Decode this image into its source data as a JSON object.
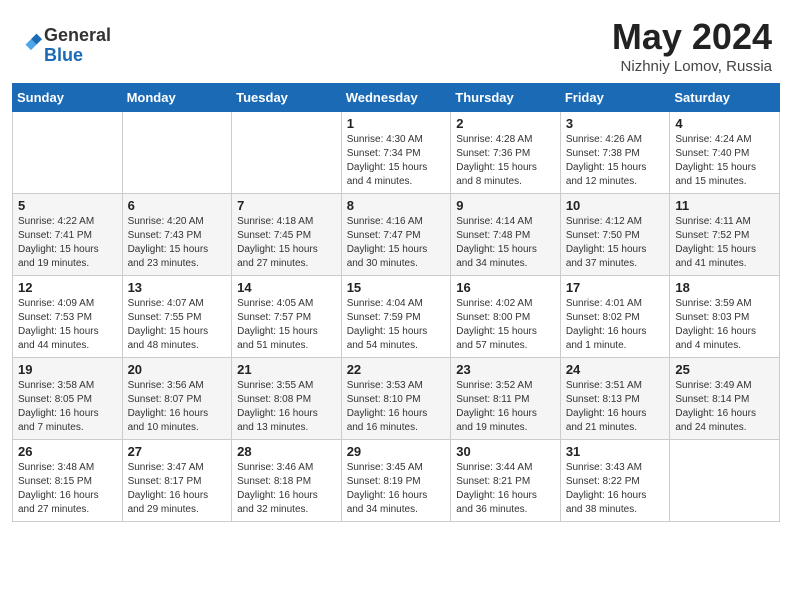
{
  "header": {
    "logo_general": "General",
    "logo_blue": "Blue",
    "month_title": "May 2024",
    "subtitle": "Nizhniy Lomov, Russia"
  },
  "days_of_week": [
    "Sunday",
    "Monday",
    "Tuesday",
    "Wednesday",
    "Thursday",
    "Friday",
    "Saturday"
  ],
  "weeks": [
    [
      {
        "day": "",
        "sunrise": "",
        "sunset": "",
        "daylight": ""
      },
      {
        "day": "",
        "sunrise": "",
        "sunset": "",
        "daylight": ""
      },
      {
        "day": "",
        "sunrise": "",
        "sunset": "",
        "daylight": ""
      },
      {
        "day": "1",
        "sunrise": "Sunrise: 4:30 AM",
        "sunset": "Sunset: 7:34 PM",
        "daylight": "Daylight: 15 hours and 4 minutes."
      },
      {
        "day": "2",
        "sunrise": "Sunrise: 4:28 AM",
        "sunset": "Sunset: 7:36 PM",
        "daylight": "Daylight: 15 hours and 8 minutes."
      },
      {
        "day": "3",
        "sunrise": "Sunrise: 4:26 AM",
        "sunset": "Sunset: 7:38 PM",
        "daylight": "Daylight: 15 hours and 12 minutes."
      },
      {
        "day": "4",
        "sunrise": "Sunrise: 4:24 AM",
        "sunset": "Sunset: 7:40 PM",
        "daylight": "Daylight: 15 hours and 15 minutes."
      }
    ],
    [
      {
        "day": "5",
        "sunrise": "Sunrise: 4:22 AM",
        "sunset": "Sunset: 7:41 PM",
        "daylight": "Daylight: 15 hours and 19 minutes."
      },
      {
        "day": "6",
        "sunrise": "Sunrise: 4:20 AM",
        "sunset": "Sunset: 7:43 PM",
        "daylight": "Daylight: 15 hours and 23 minutes."
      },
      {
        "day": "7",
        "sunrise": "Sunrise: 4:18 AM",
        "sunset": "Sunset: 7:45 PM",
        "daylight": "Daylight: 15 hours and 27 minutes."
      },
      {
        "day": "8",
        "sunrise": "Sunrise: 4:16 AM",
        "sunset": "Sunset: 7:47 PM",
        "daylight": "Daylight: 15 hours and 30 minutes."
      },
      {
        "day": "9",
        "sunrise": "Sunrise: 4:14 AM",
        "sunset": "Sunset: 7:48 PM",
        "daylight": "Daylight: 15 hours and 34 minutes."
      },
      {
        "day": "10",
        "sunrise": "Sunrise: 4:12 AM",
        "sunset": "Sunset: 7:50 PM",
        "daylight": "Daylight: 15 hours and 37 minutes."
      },
      {
        "day": "11",
        "sunrise": "Sunrise: 4:11 AM",
        "sunset": "Sunset: 7:52 PM",
        "daylight": "Daylight: 15 hours and 41 minutes."
      }
    ],
    [
      {
        "day": "12",
        "sunrise": "Sunrise: 4:09 AM",
        "sunset": "Sunset: 7:53 PM",
        "daylight": "Daylight: 15 hours and 44 minutes."
      },
      {
        "day": "13",
        "sunrise": "Sunrise: 4:07 AM",
        "sunset": "Sunset: 7:55 PM",
        "daylight": "Daylight: 15 hours and 48 minutes."
      },
      {
        "day": "14",
        "sunrise": "Sunrise: 4:05 AM",
        "sunset": "Sunset: 7:57 PM",
        "daylight": "Daylight: 15 hours and 51 minutes."
      },
      {
        "day": "15",
        "sunrise": "Sunrise: 4:04 AM",
        "sunset": "Sunset: 7:59 PM",
        "daylight": "Daylight: 15 hours and 54 minutes."
      },
      {
        "day": "16",
        "sunrise": "Sunrise: 4:02 AM",
        "sunset": "Sunset: 8:00 PM",
        "daylight": "Daylight: 15 hours and 57 minutes."
      },
      {
        "day": "17",
        "sunrise": "Sunrise: 4:01 AM",
        "sunset": "Sunset: 8:02 PM",
        "daylight": "Daylight: 16 hours and 1 minute."
      },
      {
        "day": "18",
        "sunrise": "Sunrise: 3:59 AM",
        "sunset": "Sunset: 8:03 PM",
        "daylight": "Daylight: 16 hours and 4 minutes."
      }
    ],
    [
      {
        "day": "19",
        "sunrise": "Sunrise: 3:58 AM",
        "sunset": "Sunset: 8:05 PM",
        "daylight": "Daylight: 16 hours and 7 minutes."
      },
      {
        "day": "20",
        "sunrise": "Sunrise: 3:56 AM",
        "sunset": "Sunset: 8:07 PM",
        "daylight": "Daylight: 16 hours and 10 minutes."
      },
      {
        "day": "21",
        "sunrise": "Sunrise: 3:55 AM",
        "sunset": "Sunset: 8:08 PM",
        "daylight": "Daylight: 16 hours and 13 minutes."
      },
      {
        "day": "22",
        "sunrise": "Sunrise: 3:53 AM",
        "sunset": "Sunset: 8:10 PM",
        "daylight": "Daylight: 16 hours and 16 minutes."
      },
      {
        "day": "23",
        "sunrise": "Sunrise: 3:52 AM",
        "sunset": "Sunset: 8:11 PM",
        "daylight": "Daylight: 16 hours and 19 minutes."
      },
      {
        "day": "24",
        "sunrise": "Sunrise: 3:51 AM",
        "sunset": "Sunset: 8:13 PM",
        "daylight": "Daylight: 16 hours and 21 minutes."
      },
      {
        "day": "25",
        "sunrise": "Sunrise: 3:49 AM",
        "sunset": "Sunset: 8:14 PM",
        "daylight": "Daylight: 16 hours and 24 minutes."
      }
    ],
    [
      {
        "day": "26",
        "sunrise": "Sunrise: 3:48 AM",
        "sunset": "Sunset: 8:15 PM",
        "daylight": "Daylight: 16 hours and 27 minutes."
      },
      {
        "day": "27",
        "sunrise": "Sunrise: 3:47 AM",
        "sunset": "Sunset: 8:17 PM",
        "daylight": "Daylight: 16 hours and 29 minutes."
      },
      {
        "day": "28",
        "sunrise": "Sunrise: 3:46 AM",
        "sunset": "Sunset: 8:18 PM",
        "daylight": "Daylight: 16 hours and 32 minutes."
      },
      {
        "day": "29",
        "sunrise": "Sunrise: 3:45 AM",
        "sunset": "Sunset: 8:19 PM",
        "daylight": "Daylight: 16 hours and 34 minutes."
      },
      {
        "day": "30",
        "sunrise": "Sunrise: 3:44 AM",
        "sunset": "Sunset: 8:21 PM",
        "daylight": "Daylight: 16 hours and 36 minutes."
      },
      {
        "day": "31",
        "sunrise": "Sunrise: 3:43 AM",
        "sunset": "Sunset: 8:22 PM",
        "daylight": "Daylight: 16 hours and 38 minutes."
      },
      {
        "day": "",
        "sunrise": "",
        "sunset": "",
        "daylight": ""
      }
    ]
  ]
}
